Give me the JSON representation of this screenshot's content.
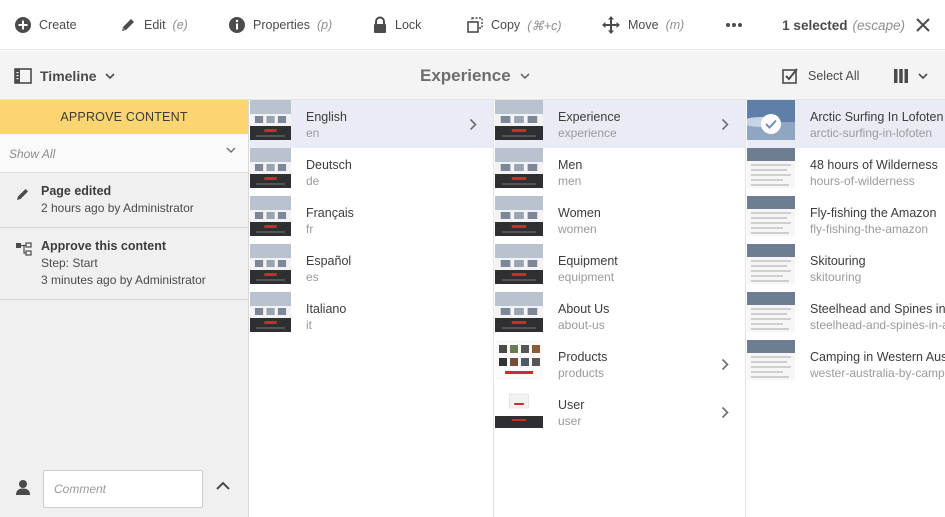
{
  "actions": [
    {
      "name": "create-action",
      "icon": "plus-circle-icon",
      "label": "Create",
      "shortcut": ""
    },
    {
      "name": "edit-action",
      "icon": "pencil-icon",
      "label": "Edit",
      "shortcut": "(e)"
    },
    {
      "name": "properties-action",
      "icon": "info-icon",
      "label": "Properties",
      "shortcut": "(p)"
    },
    {
      "name": "lock-action",
      "icon": "lock-icon",
      "label": "Lock",
      "shortcut": ""
    },
    {
      "name": "copy-action",
      "icon": "copy-icon",
      "label": "Copy",
      "shortcut": "(⌘+c)"
    },
    {
      "name": "move-action",
      "icon": "move-icon",
      "label": "Move",
      "shortcut": "(m)"
    }
  ],
  "more_icon": "ellipsis-icon",
  "selection": {
    "count_label": "1 selected",
    "escape_hint": "(escape)"
  },
  "titlebar": {
    "rail_label": "Timeline",
    "title": "Experience",
    "select_all_label": "Select All"
  },
  "rail": {
    "approve_label": "APPROVE CONTENT",
    "filter_value": "Show All",
    "events": [
      {
        "icon": "pencil-icon",
        "title": "Page edited",
        "lines": [
          "2 hours ago by Administrator"
        ]
      },
      {
        "icon": "workflow-icon",
        "title": "Approve this content",
        "lines": [
          "Step: Start",
          "3 minutes ago by Administrator"
        ]
      }
    ],
    "comment_placeholder": "Comment"
  },
  "columns": [
    {
      "rows": [
        {
          "title": "English",
          "sub": "en",
          "chevron": true,
          "active": true
        },
        {
          "title": "Deutsch",
          "sub": "de",
          "chevron": false,
          "active": false
        },
        {
          "title": "Français",
          "sub": "fr",
          "chevron": false,
          "active": false
        },
        {
          "title": "Español",
          "sub": "es",
          "chevron": false,
          "active": false
        },
        {
          "title": "Italiano",
          "sub": "it",
          "chevron": false,
          "active": false
        }
      ]
    },
    {
      "rows": [
        {
          "title": "Experience",
          "sub": "experience",
          "chevron": true,
          "active": true
        },
        {
          "title": "Men",
          "sub": "men",
          "chevron": false,
          "active": false
        },
        {
          "title": "Women",
          "sub": "women",
          "chevron": false,
          "active": false
        },
        {
          "title": "Equipment",
          "sub": "equipment",
          "chevron": false,
          "active": false
        },
        {
          "title": "About Us",
          "sub": "about-us",
          "chevron": false,
          "active": false
        },
        {
          "title": "Products",
          "sub": "products",
          "chevron": true,
          "active": false
        },
        {
          "title": "User",
          "sub": "user",
          "chevron": true,
          "active": false
        }
      ]
    },
    {
      "rows": [
        {
          "title": "Arctic Surfing In Lofoten",
          "sub": "arctic-surfing-in-lofoten",
          "chevron": false,
          "active": true,
          "selected": true
        },
        {
          "title": "48 hours of Wilderness",
          "sub": "hours-of-wilderness",
          "chevron": false,
          "active": false
        },
        {
          "title": "Fly-fishing the Amazon",
          "sub": "fly-fishing-the-amazon",
          "chevron": false,
          "active": false
        },
        {
          "title": "Skitouring",
          "sub": "skitouring",
          "chevron": false,
          "active": false
        },
        {
          "title": "Steelhead and Spines in Alaska",
          "sub": "steelhead-and-spines-in-alaska",
          "chevron": false,
          "active": false
        },
        {
          "title": "Camping in Western Australia",
          "sub": "wester-australia-by-camper",
          "chevron": false,
          "active": false
        }
      ]
    }
  ],
  "colors": {
    "approve_bar": "#fbd572",
    "active_row": "#e9ecf4",
    "rail_bg": "#f0f0f0"
  }
}
